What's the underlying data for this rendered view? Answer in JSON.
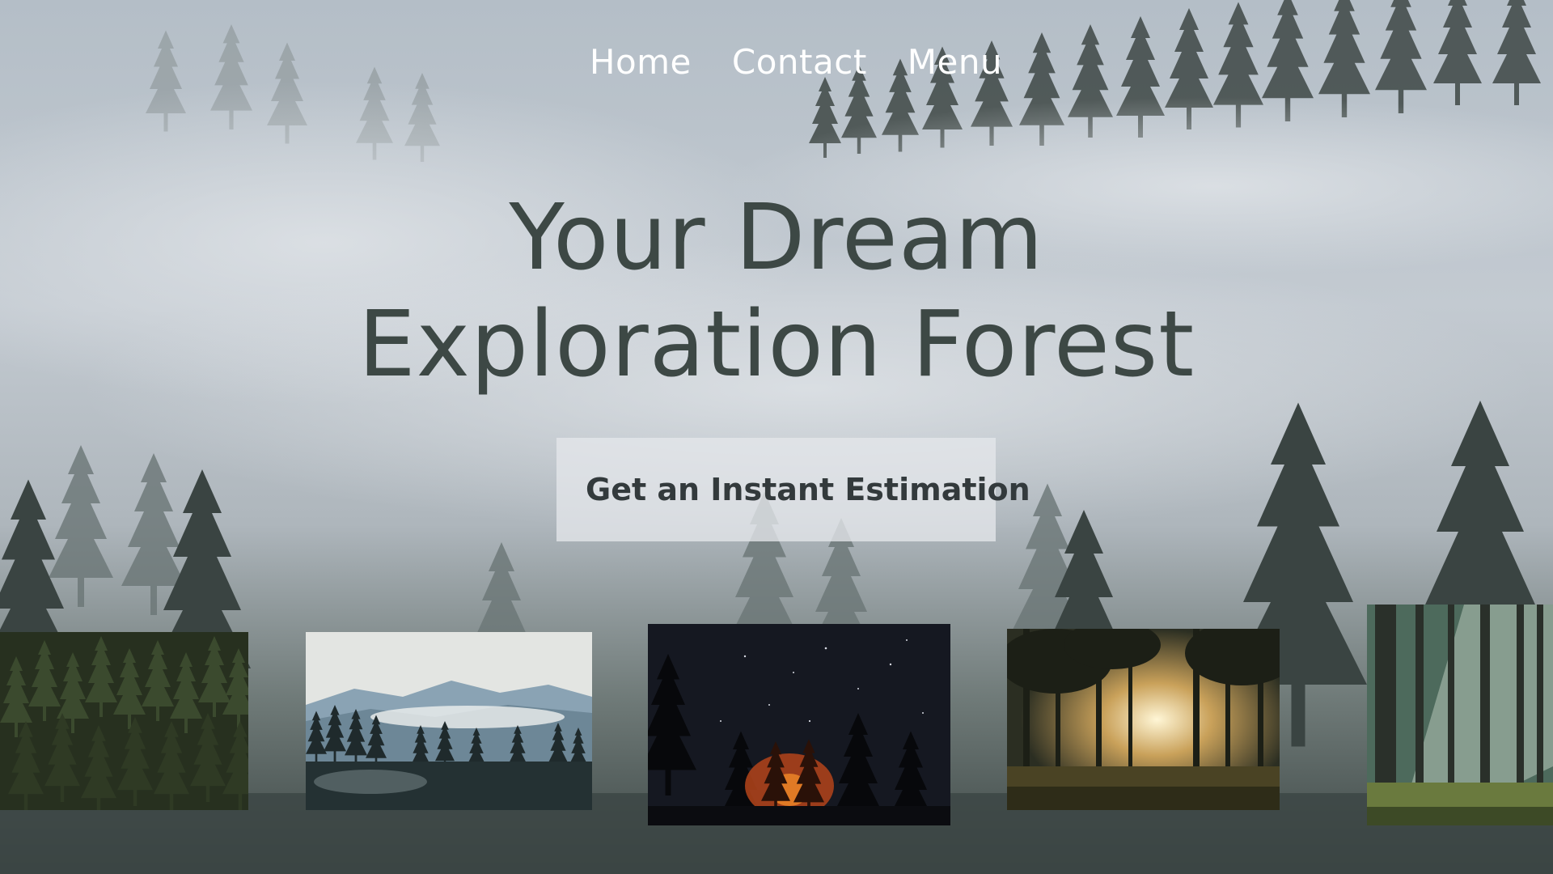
{
  "nav": {
    "items": [
      {
        "label": "Home"
      },
      {
        "label": "Contact"
      },
      {
        "label": "Menu"
      }
    ]
  },
  "hero": {
    "title_line1": "Your Dream",
    "title_line2": "Exploration Forest",
    "cta_label": "Get an Instant Estimation"
  },
  "gallery": {
    "items": [
      {
        "subject": "dense pine forest from above"
      },
      {
        "subject": "misty mountain ridges with pines"
      },
      {
        "subject": "starry night with campfire in trees"
      },
      {
        "subject": "sunrise through forest trees"
      },
      {
        "subject": "sunbeams in green forest"
      }
    ]
  },
  "colors": {
    "title": "#3d4845",
    "nav_text": "#ffffff",
    "cta_bg": "#e4e7eb",
    "cta_text": "#333a3c",
    "background_fog": "#b9c2ca"
  }
}
